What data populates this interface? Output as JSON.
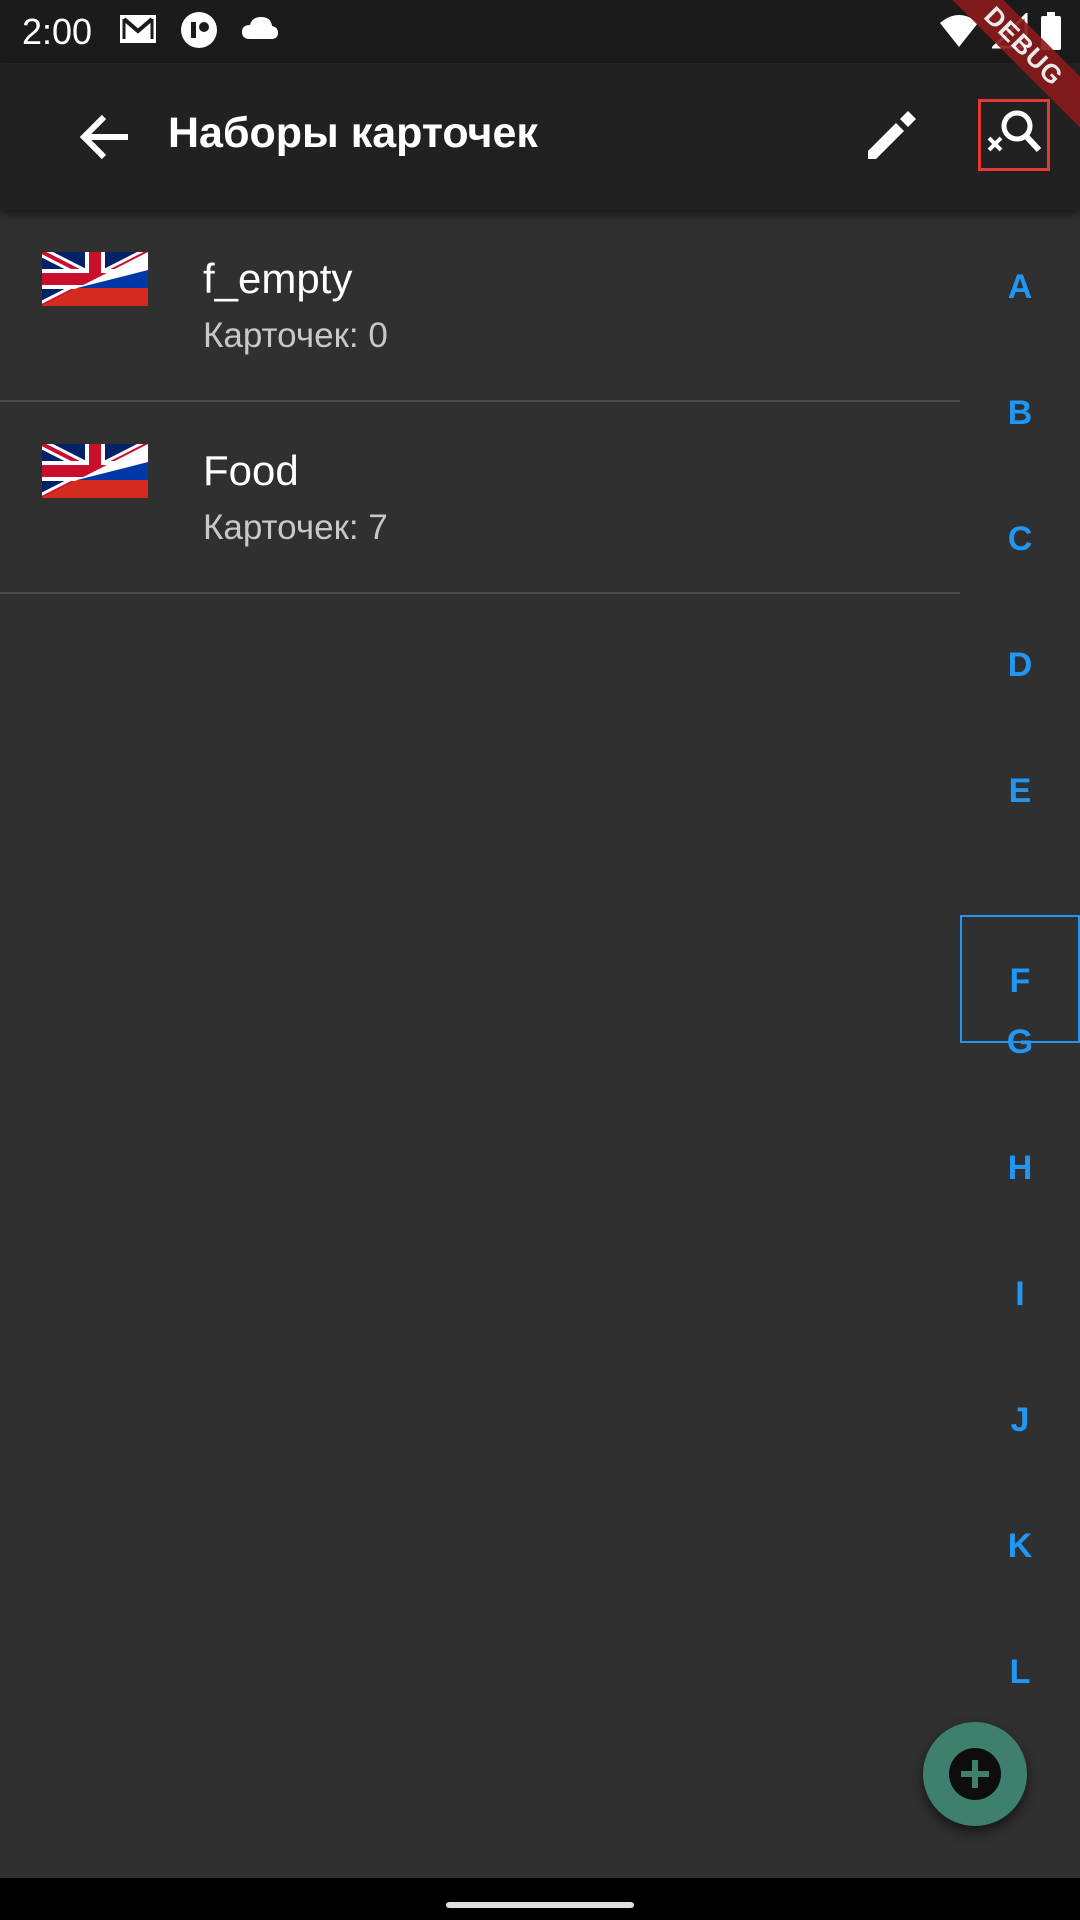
{
  "status_bar": {
    "time": "2:00",
    "left_icons": [
      "gmail-icon",
      "app-icon",
      "cloud-icon"
    ],
    "right_icons": [
      "wifi-icon",
      "signal-icon",
      "battery-icon"
    ]
  },
  "debug_banner": "DEBUG",
  "app_bar": {
    "title": "Наборы карточек",
    "back_icon": "arrow-left-icon",
    "edit_icon": "pencil-icon",
    "search_clear_icon": "search-off-icon"
  },
  "list": {
    "items": [
      {
        "title": "f_empty",
        "subtitle": "Карточек: 0",
        "flag": "uk-ru-flag"
      },
      {
        "title": "Food",
        "subtitle": "Карточек: 7",
        "flag": "uk-ru-flag"
      }
    ]
  },
  "alpha_index": {
    "letters": [
      "A",
      "B",
      "C",
      "D",
      "E",
      "F",
      "G",
      "H",
      "I",
      "J",
      "K",
      "L"
    ],
    "selected": "F"
  },
  "fab": {
    "icon": "plus-circle-icon"
  },
  "colors": {
    "background": "#303030",
    "app_bar": "#212121",
    "accent": "#2196f3",
    "fab": "#3e7f6d",
    "highlight": "#e53935"
  }
}
